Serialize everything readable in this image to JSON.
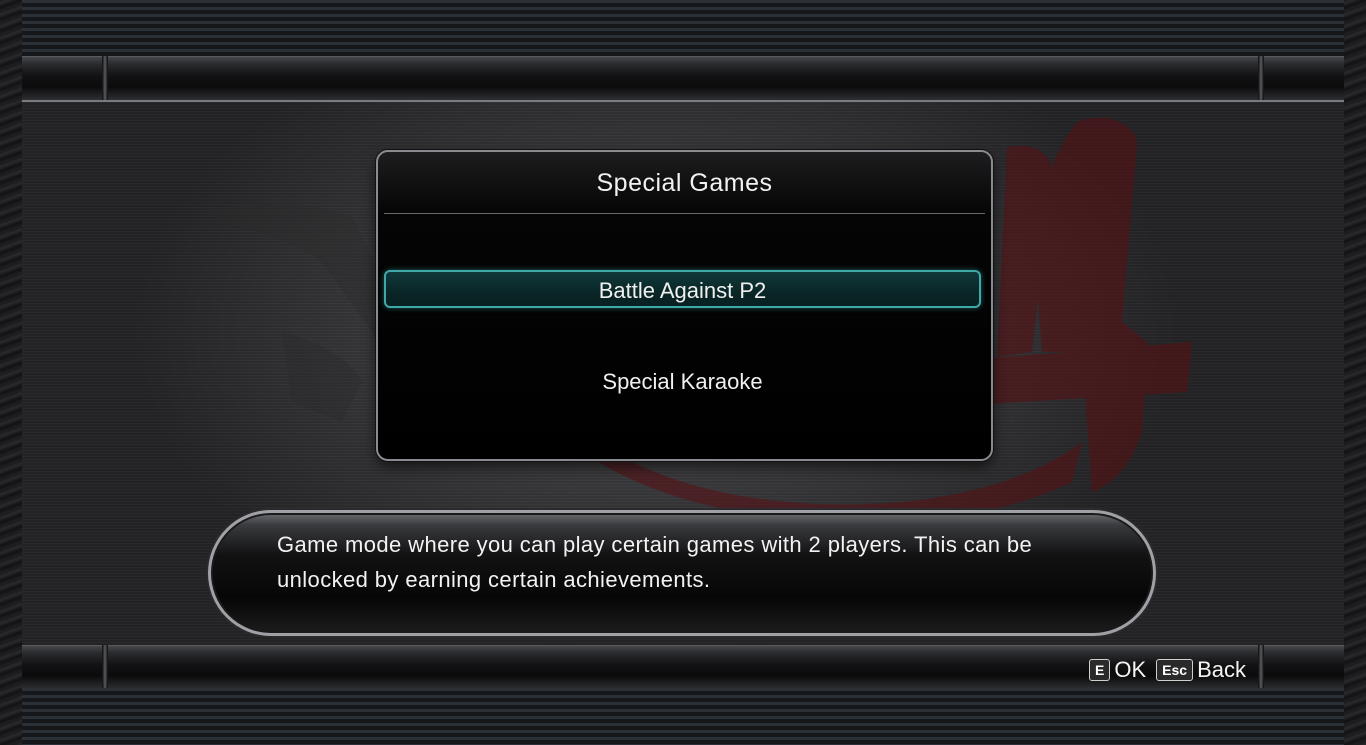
{
  "menu": {
    "title": "Special Games",
    "items": [
      {
        "label": "Battle Against P2",
        "selected": true
      },
      {
        "label": "Special Karaoke",
        "selected": false
      }
    ],
    "selection_color": "#3fa9a9"
  },
  "description": {
    "line1": "Game mode where you can play certain games with 2 players. This can be",
    "line2": "unlocked by earning certain achievements."
  },
  "controls": [
    {
      "key": "E",
      "label": "OK"
    },
    {
      "key": "Esc",
      "label": "Back"
    }
  ],
  "background": {
    "logo_accent_color": "#5a0f12",
    "logo_icon": "yakuza-4-logo-icon"
  }
}
